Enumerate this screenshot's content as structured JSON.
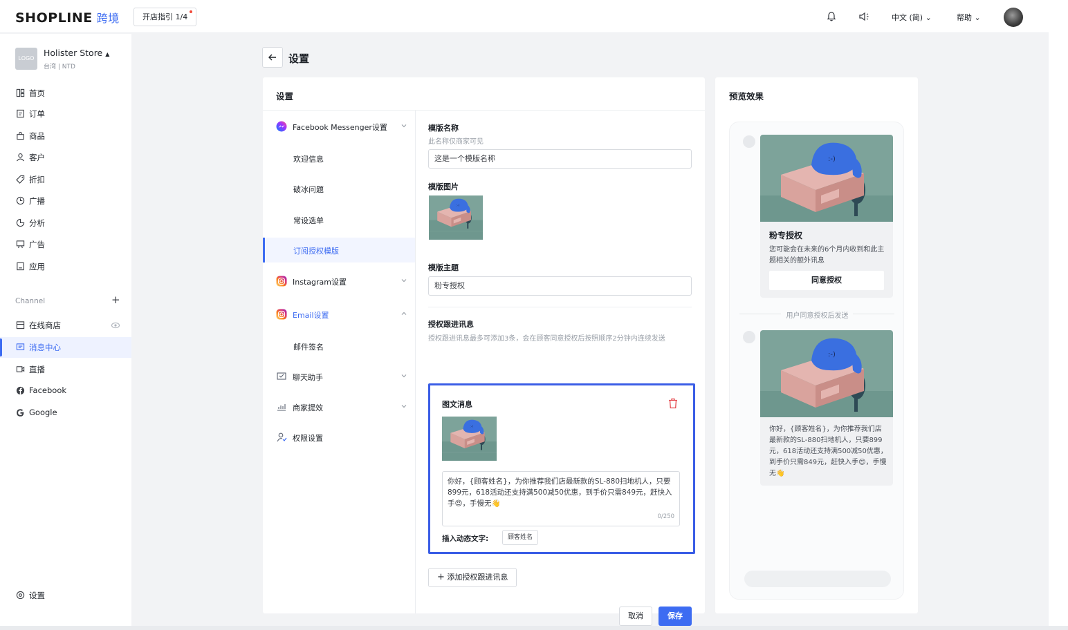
{
  "brand": {
    "name": "SHOPLINE",
    "sub": "跨境"
  },
  "topbar": {
    "guide_label": "开店指引 1/4",
    "language": "中文 (简)",
    "help": "帮助",
    "icons": [
      "bell-icon",
      "speaker-icon",
      "avatar"
    ]
  },
  "store": {
    "logo_text": "LOGO",
    "name": "Holister Store",
    "sub": "台湾 | NTD"
  },
  "sidebar": {
    "items": [
      {
        "label": "首页",
        "icon": "home-icon"
      },
      {
        "label": "订单",
        "icon": "order-icon"
      },
      {
        "label": "商品",
        "icon": "bag-icon"
      },
      {
        "label": "客户",
        "icon": "user-icon"
      },
      {
        "label": "折扣",
        "icon": "tag-icon"
      },
      {
        "label": "广播",
        "icon": "broadcast-icon"
      },
      {
        "label": "分析",
        "icon": "chart-icon"
      },
      {
        "label": "广告",
        "icon": "ad-icon"
      },
      {
        "label": "应用",
        "icon": "app-icon"
      }
    ],
    "channel_header": "Channel",
    "channels": [
      {
        "label": "在线商店",
        "icon": "store-icon"
      },
      {
        "label": "消息中心",
        "icon": "message-icon",
        "active": true
      },
      {
        "label": "直播",
        "icon": "live-icon"
      },
      {
        "label": "Facebook",
        "icon": "facebook-icon"
      },
      {
        "label": "Google",
        "icon": "google-icon"
      }
    ],
    "settings": "设置"
  },
  "page": {
    "title": "设置"
  },
  "card": {
    "title": "设置",
    "subnav": [
      {
        "label": "Facebook Messenger设置",
        "icon": "messenger-icon"
      },
      {
        "label": "欢迎信息"
      },
      {
        "label": "破冰问题"
      },
      {
        "label": "常设选单"
      },
      {
        "label": "订阅授权模版",
        "active": true
      },
      {
        "label": "Instagram设置",
        "icon": "instagram-icon"
      },
      {
        "label": "Email设置",
        "icon": "instagram-icon"
      },
      {
        "label": "邮件签名"
      },
      {
        "label": "聊天助手",
        "icon": "chat-icon"
      },
      {
        "label": "商家提效",
        "icon": "efficiency-icon"
      },
      {
        "label": "权限设置",
        "icon": "permission-icon"
      }
    ]
  },
  "form": {
    "name_label": "模版名称",
    "name_help": "此名称仅商家可见",
    "name_value": "这是一个模版名称",
    "image_label": "模版图片",
    "topic_label": "模版主题",
    "topic_value": "粉专授权",
    "follow_label": "授权跟进讯息",
    "follow_help": "授权跟进讯息最多可添加3条，会在顾客同意授权后按照顺序2分钟内连续发送",
    "msg": {
      "title": "图文消息",
      "text": "你好，{顾客姓名}，为你推荐我们店最新款的SL-880扫地机人，只要899元，618活动还支持满500减50优惠，到手价只需849元，赶快入手😍，手慢无👋",
      "counter": "0/250",
      "insert_label": "插入动态文字:",
      "chip": "顾客姓名"
    },
    "add_button": "添加授权跟进讯息",
    "cancel": "取消",
    "save": "保存"
  },
  "preview": {
    "title": "预览效果",
    "card1": {
      "title": "粉专授权",
      "body": "您可能会在未来的6个月内收到和此主题相关的额外讯息",
      "button": "同意授权"
    },
    "divider": "用户同意授权后发送",
    "card2": {
      "body": "你好，{顾客姓名}，为你推荐我们店最新款的SL-880扫地机人，只要899元，618活动还支持满500减50优惠，到手价只需849元，赶快入手😍，手慢无👋"
    }
  },
  "colors": {
    "accent": "#3d6cf2",
    "highlight_border": "#3a5de6",
    "danger": "#e5484d"
  }
}
